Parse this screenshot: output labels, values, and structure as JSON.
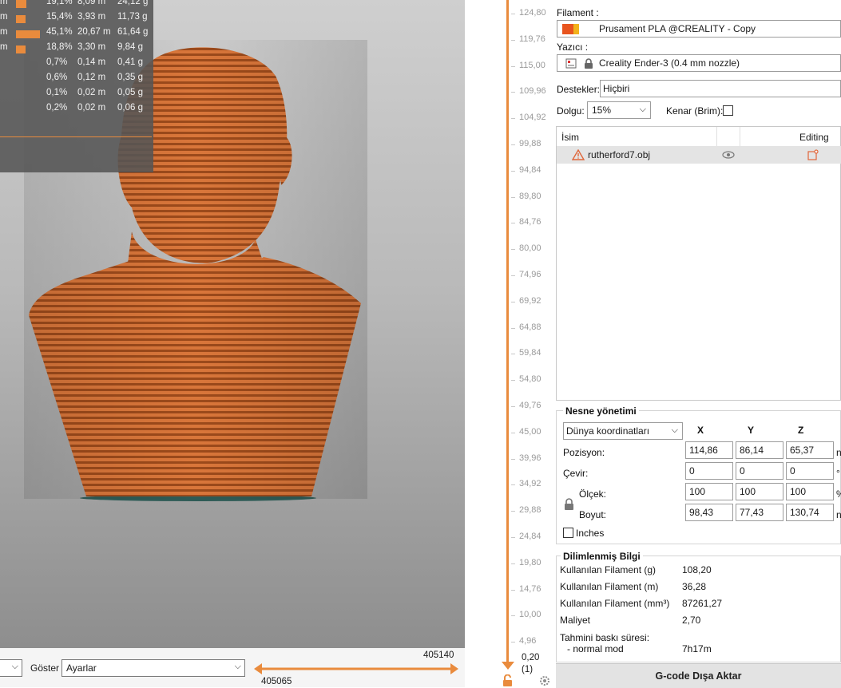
{
  "stats": {
    "rows": [
      {
        "unit": "m",
        "pct": "19,1%",
        "length": "8,09 m",
        "weight": "24,12 g",
        "bar": 0.191
      },
      {
        "unit": "m",
        "pct": "15,4%",
        "length": "3,93 m",
        "weight": "11,73 g",
        "bar": 0.154
      },
      {
        "unit": "m",
        "pct": "45,1%",
        "length": "20,67 m",
        "weight": "61,64 g",
        "bar": 0.451
      },
      {
        "unit": "m",
        "pct": "18,8%",
        "length": "3,30 m",
        "weight": "9,84 g",
        "bar": 0.188
      },
      {
        "unit": "",
        "pct": "0,7%",
        "length": "0,14 m",
        "weight": "0,41 g",
        "bar": 0
      },
      {
        "unit": "",
        "pct": "0,6%",
        "length": "0,12 m",
        "weight": "0,35 g",
        "bar": 0
      },
      {
        "unit": "",
        "pct": "0,1%",
        "length": "0,02 m",
        "weight": "0,05 g",
        "bar": 0
      },
      {
        "unit": "",
        "pct": "0,2%",
        "length": "0,02 m",
        "weight": "0,06 g",
        "bar": 0
      }
    ]
  },
  "bottom": {
    "goster_label": "Göster",
    "goster_value": "Ayarlar",
    "left_combo_value": "",
    "hslider_top": "405140",
    "hslider_bottom": "405065"
  },
  "vslider": {
    "ticks": [
      "124,80",
      "119,76",
      "115,00",
      "109,96",
      "104,92",
      "99,88",
      "94,84",
      "89,80",
      "84,76",
      "80,00",
      "74,96",
      "69,92",
      "64,88",
      "59,84",
      "54,80",
      "49,76",
      "45,00",
      "39,96",
      "34,92",
      "29,88",
      "24,84",
      "19,80",
      "14,76",
      "10,00",
      "4,96"
    ],
    "bottom_value": "0,20",
    "bottom_count": "(1)"
  },
  "panel": {
    "filament_label": "Filament :",
    "filament_value": "Prusament PLA @CREALITY - Copy",
    "printer_label": "Yazıcı :",
    "printer_value": "Creality Ender-3 (0.4 mm nozzle)",
    "supports_label": "Destekler:",
    "supports_value": "Hiçbiri",
    "infill_label": "Dolgu:",
    "infill_value": "15%",
    "brim_label": "Kenar (Brim):",
    "list_header_name": "İsim",
    "list_header_editing": "Editing",
    "object_name": "rutherford7.obj",
    "object_manip": {
      "title": "Nesne yönetimi",
      "coord_system": "Dünya koordinatları",
      "x": "X",
      "y": "Y",
      "z": "Z",
      "position_label": "Pozisyon:",
      "rotate_label": "Çevir:",
      "scale_label": "Ölçek:",
      "size_label": "Boyut:",
      "position": [
        "114,86",
        "86,14",
        "65,37"
      ],
      "rotation": [
        "0",
        "0",
        "0"
      ],
      "scale": [
        "100",
        "100",
        "100"
      ],
      "size": [
        "98,43",
        "77,43",
        "130,74"
      ],
      "position_unit": "n",
      "rotation_unit": "°",
      "scale_unit": "%",
      "size_unit": "n",
      "inches_label": "Inches"
    },
    "sliced_info": {
      "title": "Dilimlenmiş Bilgi",
      "rows": [
        {
          "k": "Kullanılan Filament (g)",
          "v": "108,20"
        },
        {
          "k": "Kullanılan Filament (m)",
          "v": "36,28"
        },
        {
          "k": "Kullanılan Filament (mm³)",
          "v": "87261,27"
        },
        {
          "k": "Maliyet",
          "v": "2,70"
        }
      ],
      "print_time_label": "Tahmini baskı süresi:",
      "mode_label": "- normal mod",
      "mode_value": "7h17m"
    },
    "export_label": "G-code Dışa Aktar"
  },
  "colors": {
    "accent": "#e98b3d",
    "model": "#c8662c",
    "filament_swatch_1": "#e8541e",
    "filament_swatch_2": "#f2b21b"
  },
  "icons": [
    "eye-icon",
    "warning-icon",
    "edit-icon",
    "lock-icon",
    "chevron-down-icon",
    "printer-icon",
    "settings-icon"
  ]
}
